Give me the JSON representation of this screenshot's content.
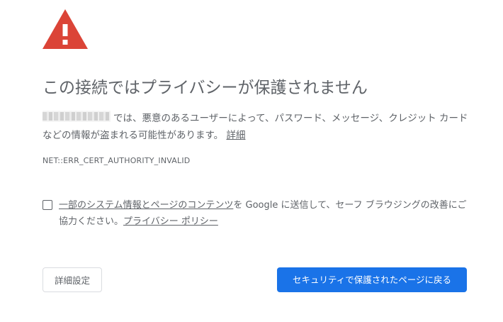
{
  "colors": {
    "warning_red": "#db4437",
    "text_gray": "#5f6368",
    "primary_blue": "#1a73e8",
    "button_border": "#dadce0"
  },
  "icon": {
    "name": "warning-triangle-icon",
    "glyph": "!"
  },
  "title": "この接続ではプライバシーが保護されません",
  "description": {
    "text": "では、悪意のあるユーザーによって、パスワード、メッセージ、クレジット カードなどの情報が盗まれる可能性があります。",
    "details_link": "詳細"
  },
  "error_code": "NET::ERR_CERT_AUTHORITY_INVALID",
  "opt_in": {
    "checked": false,
    "link_text": "一部のシステム情報とページのコンテンツ",
    "text_middle": "を Google に送信して、セーフ ブラウジングの改善にご協力ください。",
    "privacy_link": "プライバシー ポリシー"
  },
  "buttons": {
    "advanced_label": "詳細設定",
    "back_to_safety_label": "セキュリティで保護されたページに戻る"
  }
}
